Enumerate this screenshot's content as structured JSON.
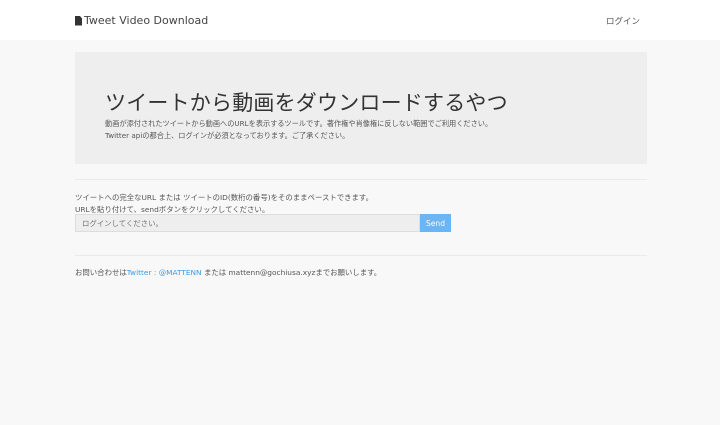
{
  "nav": {
    "brand": "Tweet Video Download",
    "login": "ログイン"
  },
  "hero": {
    "title": "ツイートから動画をダウンロードするやつ",
    "line1": "動画が添付されたツイートから動画へのURLを表示するツールです。著作権や肖像権に反しない範囲でご利用ください。",
    "line2": "Twitter apiの都合上、ログインが必須となっております。ご了承ください。"
  },
  "form": {
    "help1": "ツイートへの完全なURL または ツイートのID(数桁の番号)をそのままペーストできます。",
    "help2": "URLを貼り付けて、sendボタンをクリックしてください。",
    "placeholder": "ログインしてください。",
    "send": "Send"
  },
  "contact": {
    "prefix": "お問い合わせは",
    "link": "Twitter : @MATTENN",
    "middle": " または mattenn@gochiusa.xyzまでお願いします。"
  }
}
